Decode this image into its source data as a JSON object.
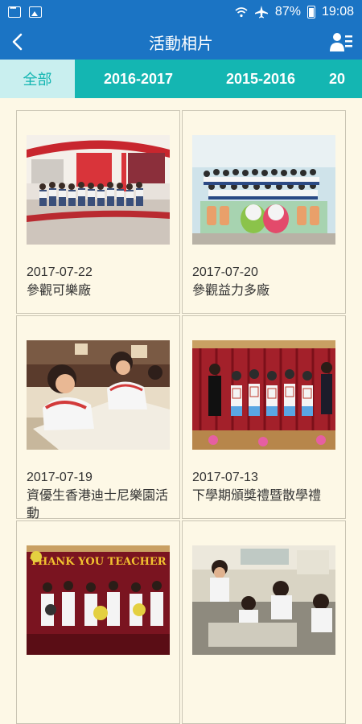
{
  "status_bar": {
    "battery": "87%",
    "time": "19:08"
  },
  "header": {
    "title": "活動相片"
  },
  "tabs": [
    "全部",
    "2016-2017",
    "2015-2016",
    "20"
  ],
  "albums": [
    {
      "date": "2017-07-22",
      "title": "參觀可樂廠"
    },
    {
      "date": "2017-07-20",
      "title": "參觀益力多廠"
    },
    {
      "date": "2017-07-19",
      "title": "資優生香港迪士尼樂園活動"
    },
    {
      "date": "2017-07-13",
      "title": "下學期頒獎禮暨散學禮"
    },
    {
      "date": "",
      "title": ""
    },
    {
      "date": "",
      "title": ""
    }
  ],
  "banner_text": "THANK YOU TEACHER"
}
